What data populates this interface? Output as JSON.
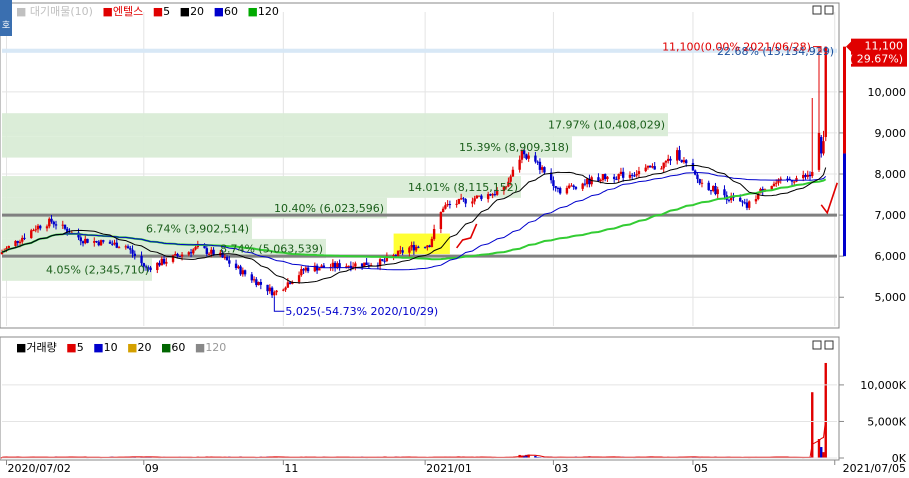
{
  "corner_label": "호",
  "price_legend": {
    "prefix": "■",
    "ma_label": "대기매물(10)",
    "items": [
      {
        "text": "엔텔스",
        "color": "#e00000"
      },
      {
        "text": "5",
        "color": "#e00000"
      },
      {
        "text": "20",
        "color": "#000000"
      },
      {
        "text": "60",
        "color": "#0000cc"
      },
      {
        "text": "120",
        "color": "#00aa00"
      }
    ]
  },
  "volume_legend": {
    "items": [
      {
        "text": "거래량",
        "color": "#000000"
      },
      {
        "text": "5",
        "color": "#e00000"
      },
      {
        "text": "10",
        "color": "#0000cc"
      },
      {
        "text": "20",
        "color": "#d4a000"
      },
      {
        "text": "60",
        "color": "#006600"
      },
      {
        "text": "120",
        "color": "#888888"
      }
    ]
  },
  "colors": {
    "up": "#e00000",
    "down": "#0000cc",
    "band_green": "#d9ecd6",
    "band_blue": "#d6e7f6",
    "highlight": "#ffff33",
    "ma20": "#000000",
    "ma60": "#0000cc",
    "ma120": "#33cc33",
    "grid": "#e4e4e4",
    "hline": "#808080"
  },
  "chart_data": [
    {
      "type": "candlestick",
      "title": "엔텔스",
      "x_range": [
        "2020-06-30",
        "2021-07-06"
      ],
      "ylim": [
        4300,
        11700
      ],
      "y_ticks": [
        5000,
        6000,
        7000,
        8000,
        9000,
        10000
      ],
      "y_tick_labels": [
        "5,000",
        "6,000",
        "7,000",
        "8,000",
        "9,000",
        "10,000"
      ],
      "x_tick_labels": [
        {
          "date": "2020-07-02",
          "label": "2020/07/02"
        },
        {
          "date": "2020-09-01",
          "label": "09"
        },
        {
          "date": "2020-11-02",
          "label": "11"
        },
        {
          "date": "2021-01-04",
          "label": "2021/01"
        },
        {
          "date": "2021-03-02",
          "label": "03"
        },
        {
          "date": "2021-05-03",
          "label": "05"
        },
        {
          "date": "2021-07-05",
          "label": "2021/07/05"
        }
      ],
      "volume_profile": [
        {
          "price_low": 10950,
          "price_high": 11050,
          "label": "22.68% (13,134,929)",
          "color": "blue"
        },
        {
          "price_low": 8920,
          "price_high": 9480,
          "label": "17.97% (10,408,029)",
          "color": "green"
        },
        {
          "price_low": 8400,
          "price_high": 8920,
          "label": "15.39% (8,909,318)",
          "color": "green"
        },
        {
          "price_low": 7420,
          "price_high": 7950,
          "label": "14.01% (8,115,152)",
          "color": "green"
        },
        {
          "price_low": 6920,
          "price_high": 7420,
          "label": "10.40% (6,023,596)",
          "color": "green"
        },
        {
          "price_low": 6420,
          "price_high": 6920,
          "label": "6.74% (3,902,514)",
          "color": "green"
        },
        {
          "price_low": 5950,
          "price_high": 6420,
          "label": "8.74% (5,063,539)",
          "color": "green"
        },
        {
          "price_low": 5400,
          "price_high": 5950,
          "label": "4.05% (2,345,710)",
          "color": "green"
        }
      ],
      "horizontal_lines": [
        7000,
        6000
      ],
      "highlight_box": {
        "date_from": "2020-12-21",
        "date_to": "2021-01-15",
        "price_low": 6050,
        "price_high": 6550
      },
      "high_annotation": {
        "value": 11100,
        "date": "2021-06-28",
        "label": "11,100(0.00% 2021/06/28)"
      },
      "low_annotation": {
        "value": 5025,
        "date": "2020-10-29",
        "label": "5,025(-54.73% 2020/10/29)"
      },
      "last_price": {
        "value": 11100,
        "label": "11,100",
        "change_label": "( 29.67%)"
      },
      "ohlc": [],
      "volume": {
        "ylim": [
          0,
          14500
        ],
        "y_ticks": [
          0,
          5000,
          10000
        ],
        "y_tick_labels": [
          "0K",
          "5,000K",
          "10,000K"
        ],
        "unit": "K"
      }
    }
  ]
}
